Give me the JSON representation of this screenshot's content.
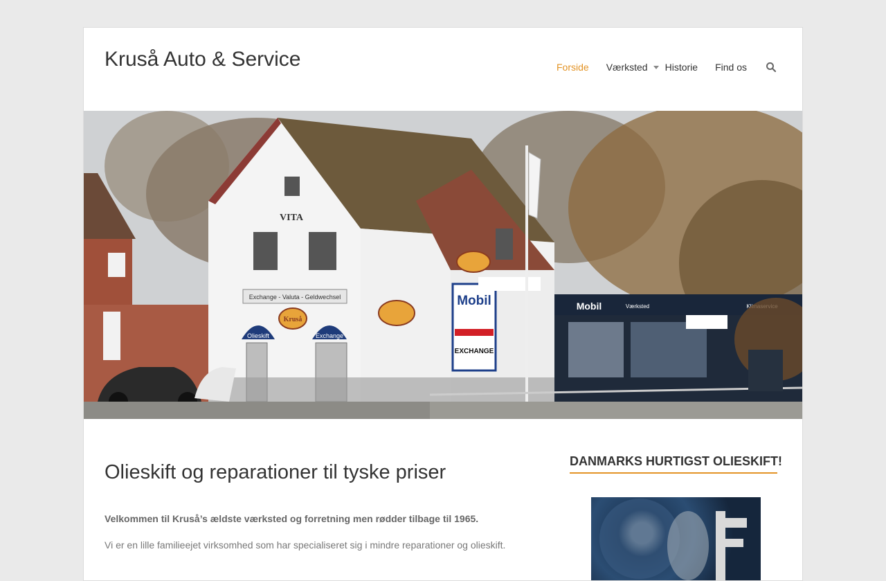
{
  "site": {
    "title": "Kruså Auto & Service"
  },
  "nav": {
    "items": [
      {
        "label": "Forside",
        "active": true
      },
      {
        "label": "Værksted",
        "has_dropdown": true
      },
      {
        "label": "Historie"
      },
      {
        "label": "Find os"
      }
    ],
    "search_icon": "search-icon"
  },
  "hero": {
    "signs": {
      "vita": "VITA",
      "exchange_band": "Exchange - Valuta - Geldwechsel",
      "olieskift": "Olieskift",
      "exchange_awning": "Exchange",
      "krusa_logo": "Kruså",
      "mobil": "Mobil",
      "exchange_sign": "EXCHANGE",
      "vaerksted_sign": "Værksted",
      "klimaservice": "Klimaservice"
    }
  },
  "content": {
    "title": "Olieskift og reparationer til tyske priser",
    "lead": "Velkommen til Kruså’s ældste værksted og forretning men rødder tilbage til 1965.",
    "paragraph": "Vi er en lille familieejet virksomhed som har specialiseret sig i mindre reparationer og olieskift."
  },
  "sidebar": {
    "widget_title": "DANMARKS HURTIGST OLIESKIFT!"
  },
  "colors": {
    "accent": "#e39325",
    "background": "#eaeaea"
  }
}
